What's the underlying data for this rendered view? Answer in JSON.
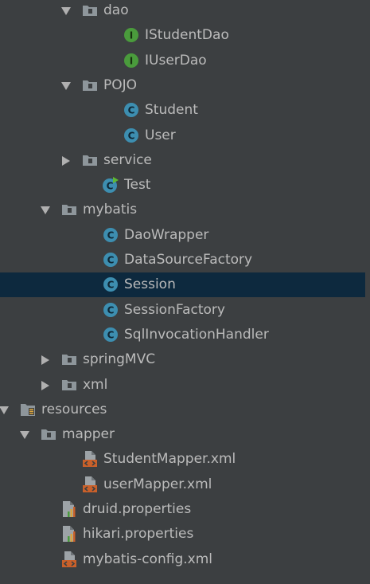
{
  "tree": {
    "items": [
      {
        "label": "dao",
        "icon": "folder-icon",
        "expanded": true,
        "level": 4
      },
      {
        "label": "IStudentDao",
        "icon": "interface-icon",
        "level": 6
      },
      {
        "label": "IUserDao",
        "icon": "interface-icon",
        "level": 6
      },
      {
        "label": "POJO",
        "icon": "folder-icon",
        "expanded": true,
        "level": 4
      },
      {
        "label": "Student",
        "icon": "class-icon",
        "level": 6
      },
      {
        "label": "User",
        "icon": "class-icon",
        "level": 6
      },
      {
        "label": "service",
        "icon": "folder-icon",
        "expanded": false,
        "level": 4
      },
      {
        "label": "Test",
        "icon": "runnable-class-icon",
        "level": 5
      },
      {
        "label": "mybatis",
        "icon": "folder-icon",
        "expanded": true,
        "level": 3
      },
      {
        "label": "DaoWrapper",
        "icon": "class-icon",
        "level": 5
      },
      {
        "label": "DataSourceFactory",
        "icon": "class-icon",
        "level": 5
      },
      {
        "label": "Session",
        "icon": "class-icon",
        "level": 5,
        "selected": true
      },
      {
        "label": "SessionFactory",
        "icon": "class-icon",
        "level": 5
      },
      {
        "label": "SqlInvocationHandler",
        "icon": "class-icon",
        "level": 5
      },
      {
        "label": "springMVC",
        "icon": "folder-icon",
        "expanded": false,
        "level": 3
      },
      {
        "label": "xml",
        "icon": "folder-icon",
        "expanded": false,
        "level": 3
      },
      {
        "label": "resources",
        "icon": "resources-folder-icon",
        "expanded": true,
        "level": 1
      },
      {
        "label": "mapper",
        "icon": "folder-icon",
        "expanded": true,
        "level": 2
      },
      {
        "label": "StudentMapper.xml",
        "icon": "xml-file-icon",
        "level": 4
      },
      {
        "label": "userMapper.xml",
        "icon": "xml-file-icon",
        "level": 4
      },
      {
        "label": "druid.properties",
        "icon": "properties-file-icon",
        "level": 3
      },
      {
        "label": "hikari.properties",
        "icon": "properties-file-icon",
        "level": 3
      },
      {
        "label": "mybatis-config.xml",
        "icon": "xml-file-icon",
        "level": 3
      }
    ]
  },
  "colors": {
    "background": "#3c3f41",
    "selection": "#0d293e",
    "text": "#bbbbbb",
    "arrow": "#b0b0b0",
    "folder": "#8e969b",
    "class_icon": "#3d8eb0",
    "interface_icon": "#4a9b3c",
    "xml_icon": "#c9602a"
  }
}
